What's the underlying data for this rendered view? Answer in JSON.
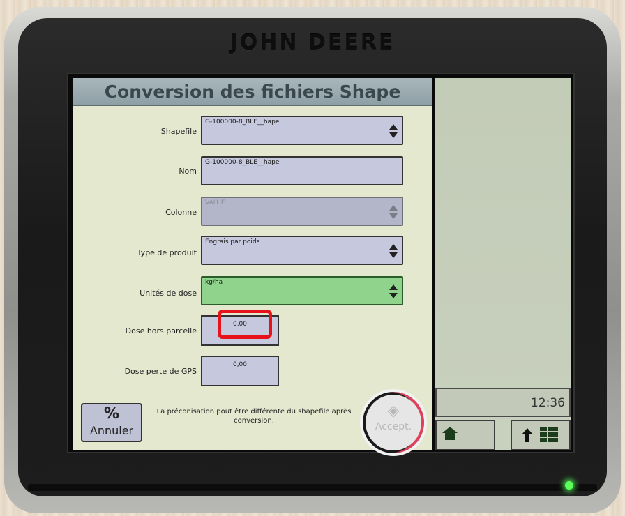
{
  "device": {
    "brand": "JOHN DEERE"
  },
  "screen": {
    "title": "Conversion des fichiers Shape",
    "fields": {
      "shapefile": {
        "label": "Shapefile",
        "value": "G-100000-8_BLE__hape"
      },
      "nom": {
        "label": "Nom",
        "value": "G-100000-8_BLE__hape"
      },
      "colonne": {
        "label": "Colonne",
        "value": "VALUE"
      },
      "type_produit": {
        "label": "Type de produit",
        "value": "Engrais par poids"
      },
      "unites_dose": {
        "label": "Unités de dose",
        "value": "kg/ha"
      },
      "dose_hors_parcelle": {
        "label": "Dose hors parcelle",
        "value": "0,00"
      },
      "dose_perte_gps": {
        "label": "Dose perte de GPS",
        "value": "0,00"
      }
    },
    "note": "La préconisation pout être différente du shapefile après conversion.",
    "buttons": {
      "cancel": {
        "icon": "%",
        "label": "Annuler"
      },
      "accept": {
        "icon": "◈",
        "label": "Accept."
      }
    }
  },
  "side_panel": {
    "clock": "12:36"
  },
  "colors": {
    "highlight": "#e8121a",
    "active_field": "#8fd38c",
    "status_led": "#5cff5c"
  }
}
